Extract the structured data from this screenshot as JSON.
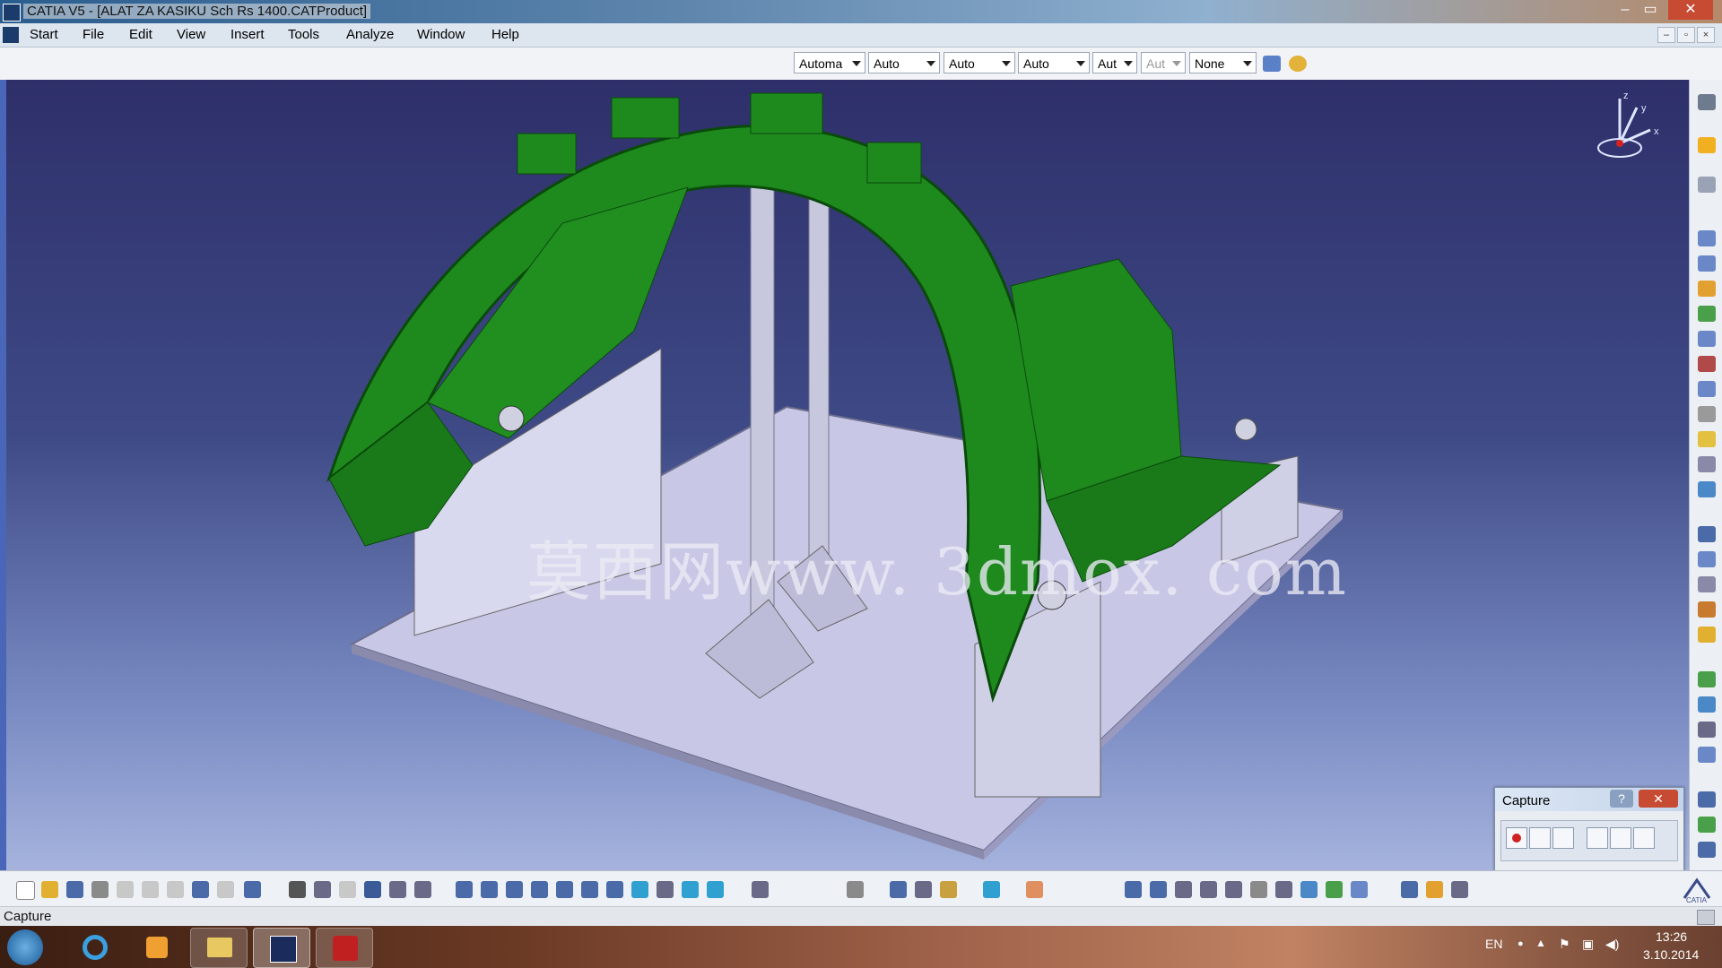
{
  "window": {
    "title": "CATIA V5 - [ALAT ZA KASIKU Sch Rs 1400.CATProduct]",
    "minimize": "‒",
    "maximize": "▭",
    "close": "✕"
  },
  "menu": {
    "items": [
      "Start",
      "File",
      "Edit",
      "View",
      "Insert",
      "Tools",
      "Analyze",
      "Window",
      "Help"
    ]
  },
  "graphic_toolbar": {
    "combos": [
      "Automa",
      "Auto",
      "Auto",
      "Auto",
      "Aut",
      "Aut",
      "None"
    ]
  },
  "viewport": {
    "watermark": "莫西网www. 3dmox. com",
    "compass": {
      "x": "x",
      "y": "y",
      "z": "z"
    },
    "colors": {
      "part_green": "#1e8a1e",
      "plate_lilac": "#c8c8e6",
      "background_top": "#2e2f6a"
    }
  },
  "capture_panel": {
    "title": "Capture",
    "help": "?",
    "close": "✕",
    "tools": [
      "record-icon",
      "select-icon",
      "options-icon",
      "capture-mode-icon",
      "image-icon",
      "album-icon"
    ]
  },
  "status": {
    "text": "Capture"
  },
  "taskbar": {
    "lang": "EN",
    "time": "13:26",
    "date": "3.10.2014"
  }
}
